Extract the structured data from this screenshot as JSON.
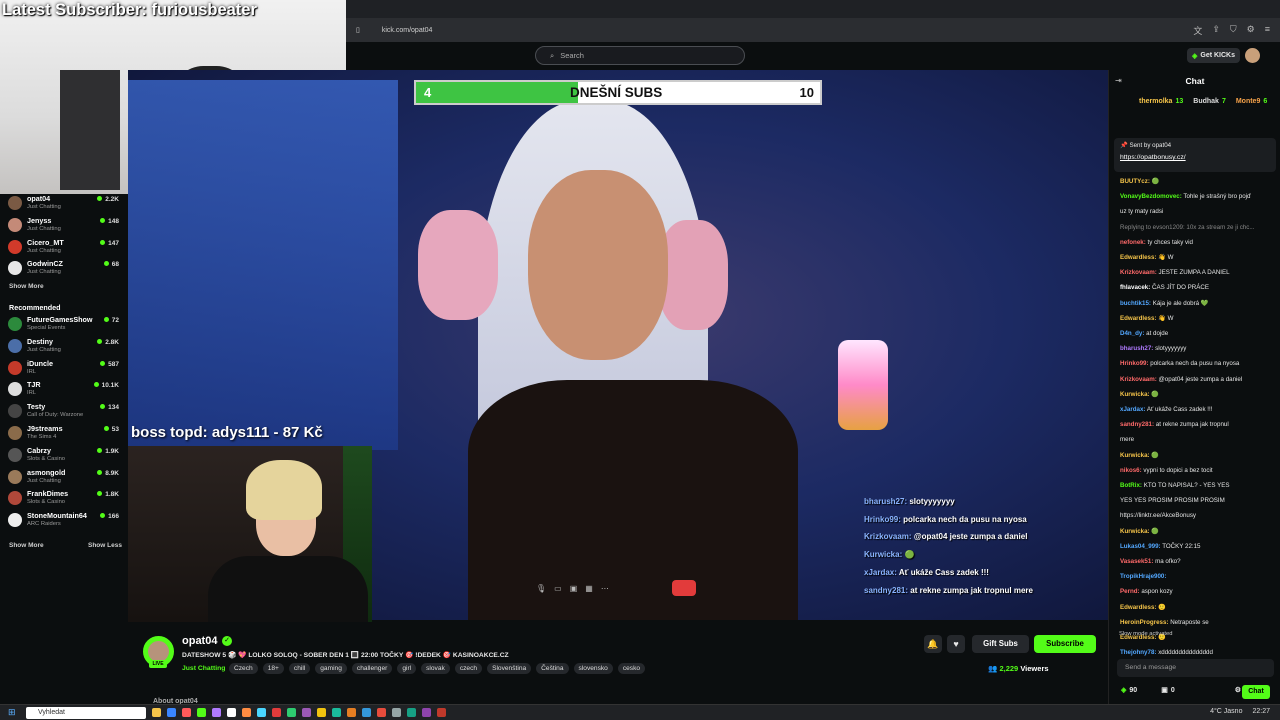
{
  "overlay": {
    "subscriber_text": "Latest Subscriber: furiousbeater",
    "subs_goal": {
      "current": "4",
      "label": "DNEŠNÍ SUBS",
      "goal": "10",
      "progress": 0.4
    },
    "boss_text": "boss topd:  adys111 - 87 Kč",
    "chat_lines": [
      {
        "user": "bharush27:",
        "text": "slotyyyyyyy"
      },
      {
        "user": "Hrinko99:",
        "text": "polcarka nech da pusu na nyosa"
      },
      {
        "user": "Krizkovaam:",
        "text": "@opat04 jeste zumpa a daniel"
      },
      {
        "user": "Kurwicka:",
        "text": "🟢"
      },
      {
        "user": "xJardax:",
        "text": "Ať ukáže Cass zadek !!!"
      },
      {
        "user": "sandny281:",
        "text": "at rekne zumpa jak tropnul mere"
      }
    ]
  },
  "browser": {
    "url": "kick.com/opat04",
    "search_placeholder": "Search",
    "get_kicks": "Get KICKs"
  },
  "sidebar": {
    "following": [
      {
        "name": "opat04",
        "category": "Just Chatting",
        "viewers": "2.2K",
        "color": "#7a5a44"
      },
      {
        "name": "Jenyss",
        "category": "Just Chatting",
        "viewers": "148",
        "color": "#c48a78"
      },
      {
        "name": "Cicero_MT",
        "category": "Just Chatting",
        "viewers": "147",
        "color": "#d23a2a"
      },
      {
        "name": "GodwinCZ",
        "category": "Just Chatting",
        "viewers": "68",
        "color": "#e7e7e7"
      }
    ],
    "show_more_1": "Show More",
    "recommended_title": "Recommended",
    "recommended": [
      {
        "name": "FutureGamesShow",
        "category": "Special Events",
        "viewers": "72",
        "color": "#2c8a3c"
      },
      {
        "name": "Destiny",
        "category": "Just Chatting",
        "viewers": "2.8K",
        "color": "#4b6ea8"
      },
      {
        "name": "iDuncle",
        "category": "IRL",
        "viewers": "587",
        "color": "#c43a2a"
      },
      {
        "name": "TJR",
        "category": "IRL",
        "viewers": "10.1K",
        "color": "#ddd"
      },
      {
        "name": "Testy",
        "category": "Call of Duty: Warzone",
        "viewers": "134",
        "color": "#444"
      },
      {
        "name": "J9streams",
        "category": "The Sims 4",
        "viewers": "53",
        "color": "#8a6b4a"
      },
      {
        "name": "Cabrzy",
        "category": "Slots & Casino",
        "viewers": "1.9K",
        "color": "#555"
      },
      {
        "name": "asmongold",
        "category": "Just Chatting",
        "viewers": "8.9K",
        "color": "#9a7a5a"
      },
      {
        "name": "FrankDimes",
        "category": "Slots & Casino",
        "viewers": "1.8K",
        "color": "#b0483a"
      },
      {
        "name": "StoneMountain64",
        "category": "ARC Raiders",
        "viewers": "166",
        "color": "#eee"
      }
    ],
    "show_more_2": "Show More",
    "show_less": "Show Less"
  },
  "channel": {
    "name": "opat04",
    "live": "LIVE",
    "title": "DATESHOW 5 🎲 💖 LOLKO SOLOQ - SOBER DEN 1 🔳 22:00 TOČKY 🎯 !DEDEK 🎯 KASINOAKCE.CZ",
    "category": "Just Chatting",
    "tags": [
      "Czech",
      "18+",
      "chill",
      "gaming",
      "challenger",
      "girl",
      "slovak",
      "czech",
      "Slovenština",
      "Čeština",
      "slovensko",
      "cesko"
    ],
    "gift_subs": "Gift Subs",
    "subscribe": "Subscribe",
    "viewers_count": "2,229",
    "viewers_label": "Viewers",
    "about": "About opat04"
  },
  "chat": {
    "title": "Chat",
    "gifters": [
      {
        "name": "thermolka",
        "count": "13"
      },
      {
        "name": "Budhak",
        "count": "7"
      },
      {
        "name": "Monte9",
        "count": "6"
      }
    ],
    "pinned_by": "Sent by",
    "pinned_user": "opat04",
    "pinned_link": "https://opatbonusy.cz/",
    "messages": [
      {
        "user": "BUUTYcz:",
        "text": "🟢",
        "color": "#f6c54a"
      },
      {
        "user": "VonavyBezdomovec:",
        "text": "Tohle je strašný bro pojď",
        "color": "#53fc18"
      },
      {
        "user": "",
        "text": "uz ty maty radsi",
        "color": "#fff"
      },
      {
        "user": "",
        "text": "Replying to evson1209: 10x za stream ze ji chc...",
        "color": "#888"
      },
      {
        "user": "nefonek:",
        "text": "ty chces taky vid",
        "color": "#ff6a6a"
      },
      {
        "user": "Edwardless:",
        "text": "👋 W",
        "color": "#f6c54a"
      },
      {
        "user": "Krizkovaam:",
        "text": "JESTE ZUMPA A DANIEL",
        "color": "#ff6a6a"
      },
      {
        "user": "fhlavacek:",
        "text": "ČAS JÍT DO PRÁCE",
        "color": "#fff"
      },
      {
        "user": "buchtik15:",
        "text": "Kája je ale dobrá 💚",
        "color": "#53a8ff"
      },
      {
        "user": "Edwardless:",
        "text": "👋 W",
        "color": "#f6c54a"
      },
      {
        "user": "D4n_dy:",
        "text": "at dojde",
        "color": "#53a8ff"
      },
      {
        "user": "bharush27:",
        "text": "slotyyyyyyy",
        "color": "#b07aff"
      },
      {
        "user": "Hrinko99:",
        "text": "polcarka nech da pusu na nyosa",
        "color": "#ff6a6a"
      },
      {
        "user": "Krizkovaam:",
        "text": "@opat04 jeste zumpa a daniel",
        "color": "#ff6a6a"
      },
      {
        "user": "Kurwicka:",
        "text": "🟢",
        "color": "#f6c54a"
      },
      {
        "user": "xJardax:",
        "text": "Ať ukáže Cass zadek !!!",
        "color": "#53a8ff"
      },
      {
        "user": "sandny281:",
        "text": "at rekne zumpa jak tropnul",
        "color": "#ff6a6a"
      },
      {
        "user": "",
        "text": "mere",
        "color": "#fff"
      },
      {
        "user": "Kurwicka:",
        "text": "🟢",
        "color": "#f6c54a"
      },
      {
        "user": "nikos6:",
        "text": "vypni to dopici a bez tocit",
        "color": "#ff6a6a"
      },
      {
        "user": "BotRix:",
        "text": "KTO TO NAPISAL? - YES YES",
        "color": "#53fc18"
      },
      {
        "user": "",
        "text": "YES YES PROSIM PROSIM PROSIM",
        "color": "#fff"
      },
      {
        "user": "",
        "text": "https://linktr.ee/AkceBonusy",
        "color": "#fff"
      },
      {
        "user": "Kurwicka:",
        "text": "🟢",
        "color": "#f6c54a"
      },
      {
        "user": "Lukas04_999:",
        "text": "TOČKY 22:15",
        "color": "#53a8ff"
      },
      {
        "user": "Vasasek51:",
        "text": "ma ofko?",
        "color": "#ff6a6a"
      },
      {
        "user": "TropikHraje900:",
        "text": "",
        "color": "#53a8ff"
      },
      {
        "user": "Pernd:",
        "text": "aspon kozy",
        "color": "#ff6a6a"
      },
      {
        "user": "Edwardless:",
        "text": "🙂",
        "color": "#f6c54a"
      },
      {
        "user": "HeroinProgress:",
        "text": "Netraposte se",
        "color": "#f6c54a"
      },
      {
        "user": "Edwardless:",
        "text": "🙂",
        "color": "#f6c54a"
      },
      {
        "user": "Thejohny78:",
        "text": "xddddddddddddddd",
        "color": "#53a8ff"
      }
    ],
    "slow_mode": "Slow mode activated",
    "input_placeholder": "Send a message",
    "kicks": "90",
    "points": "0",
    "chat_button": "Chat"
  },
  "taskbar": {
    "search": "Vyhledat",
    "weather": "4°C Jasno",
    "time": "22:27"
  }
}
